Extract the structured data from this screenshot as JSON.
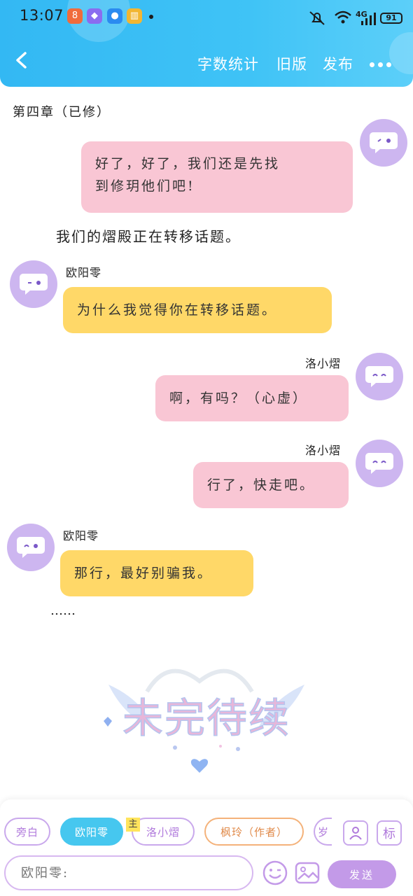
{
  "status_bar": {
    "time": "13:07",
    "network": "4G",
    "battery": "91",
    "apps": [
      {
        "icon": "app-red-icon",
        "glyph": "8",
        "color": "#f06b3c"
      },
      {
        "icon": "app-gradient-icon",
        "glyph": "◆",
        "color": "#8a6cf0"
      },
      {
        "icon": "app-blue-icon",
        "glyph": "●",
        "color": "#2a8bf0"
      },
      {
        "icon": "app-book-icon",
        "glyph": "▥",
        "color": "#f2b632"
      }
    ]
  },
  "header": {
    "word_count_label": "字数统计",
    "old_version_label": "旧版",
    "publish_label": "发布",
    "accent_color": "#3fc3f6"
  },
  "chapter_title": "第四章（已修）",
  "messages": [
    {
      "side": "right",
      "speaker": "",
      "text_line1": "好了，好了，我们还是先找",
      "text_line2": "到修玥他们吧!",
      "bubble_color": "#f9c6d4"
    },
    {
      "type": "narration",
      "text": "我们的熠殿正在转移话题。"
    },
    {
      "side": "left",
      "speaker": "欧阳零",
      "text": "为什么我觉得你在转移话题。",
      "bubble_color": "#ffd868"
    },
    {
      "side": "right",
      "speaker": "洛小熠",
      "text": "啊，有吗？（心虚）",
      "bubble_color": "#f9c6d4"
    },
    {
      "side": "right",
      "speaker": "洛小熠",
      "text": "行了，快走吧。",
      "bubble_color": "#f9c6d4"
    },
    {
      "side": "left",
      "speaker": "欧阳零",
      "text": "那行，最好别骗我。",
      "bubble_color": "#ffd868"
    },
    {
      "type": "narration",
      "text": "……"
    }
  ],
  "banner_logo": "未完待续",
  "role_bar": {
    "chips": [
      "旁白",
      "欧阳零",
      "洛小熠",
      "枫玲（作者）",
      "岁"
    ],
    "main_badge": "主",
    "active_chip": "欧阳零",
    "tag_button": "标"
  },
  "composer": {
    "placeholder": "欧阳零:",
    "send_label": "发送"
  }
}
